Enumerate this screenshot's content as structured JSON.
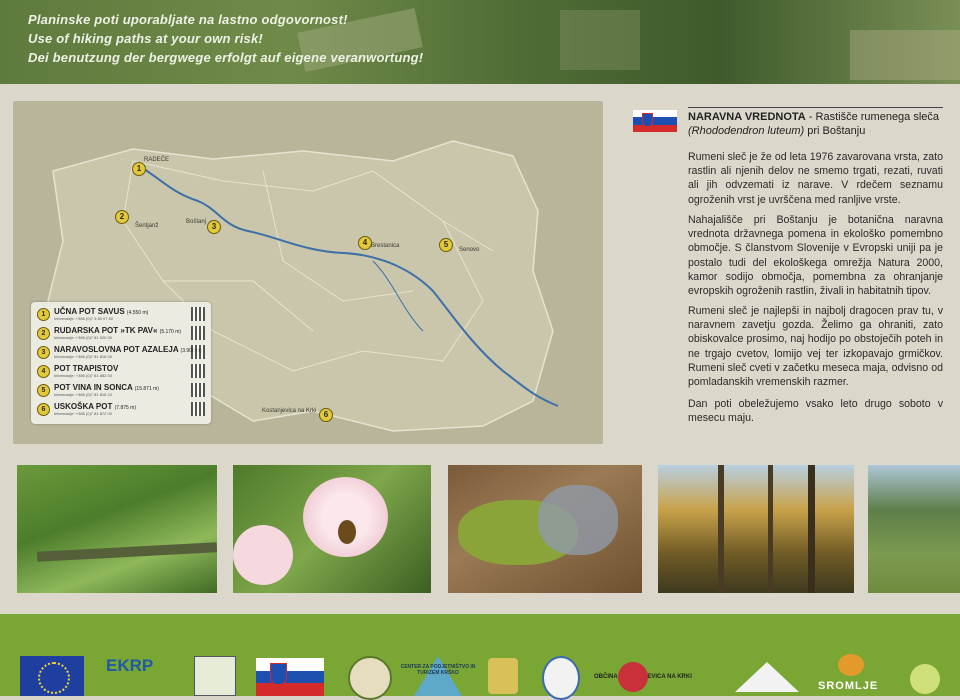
{
  "banner": {
    "lines": [
      "Planinske poti uporabljate na lastno odgovornost!",
      "Use of hiking paths at your own risk!",
      "Dei benutzung der bergwege erfolgt auf eigene veranwortung!"
    ]
  },
  "map": {
    "towns": [
      "RADEČE",
      "Šentjanž",
      "Boštanj",
      "Brestanica",
      "Senovo",
      "Kostanjevica na Krki"
    ],
    "markers": [
      "1",
      "2",
      "3",
      "4",
      "5",
      "6"
    ]
  },
  "legend": [
    {
      "num": "1",
      "name": "UČNA POT SAVUS",
      "len": "(4.550 m)",
      "info": "Informacije: +386 (0)7 3 80 07 60"
    },
    {
      "num": "2",
      "name": "RUDARSKA POT »TK PAV«",
      "len": "(5.170 m)",
      "info": "Informacije: +386 (0)7 81 920 00"
    },
    {
      "num": "3",
      "name": "NARAVOSLOVNA POT AZALEJA",
      "len": "(3.900 m)",
      "info": "Informacije: +386 (0)7 81 816 00"
    },
    {
      "num": "4",
      "name": "POT TRAPISTOV",
      "len": "",
      "info": "Informacije: +386 (0)7 81 882 00"
    },
    {
      "num": "5",
      "name": "POT VINA IN SONCA",
      "len": "(15.871 m)",
      "info": "Informacije: +386 (0)7 81 816 24"
    },
    {
      "num": "6",
      "name": "USKOŠKA POT",
      "len": "(7.875 m)",
      "info": "Informacije: +386 (0)7 81 872 00"
    }
  ],
  "article": {
    "title_bold": "NARAVNA VREDNOTA",
    "title_rest": " - Rastišče rumenega sleča",
    "title_italic": "(Rhododendron luteum)",
    "title_tail": " pri Boštanju",
    "p1": "Rumeni sleč je že od leta 1976 zavarovana vrsta, zato rastlin ali njenih delov ne smemo trgati, rezati, ruvati ali jih odvzemati iz narave. V rdečem seznamu ogroženih vrst je uvrščena med ranljive vrste.",
    "p2": "Nahajališče pri Boštanju je botanična naravna vrednota državnega pomena in ekološko pomembno območje. S članstvom Slovenije v Evropski uniji pa je postalo tudi del ekološkega omrežja Natura 2000, kamor sodijo območja, pomembna za ohranjanje evropskih ogroženih rastlin, živali in habitatnih tipov.",
    "p3": "Rumeni sleč je najlepši in najbolj dragocen prav tu, v naravnem zavetju gozda. Želimo ga ohraniti, zato obiskovalce prosimo, naj hodijo po obstoječih poteh in ne trgajo cvetov, lomijo vej ter izkopavajo grmičkov. Rumeni sleč cveti v začetku meseca maja, odvisno od pomladanskih vremenskih razmer.",
    "p4": "Dan poti obeležujemo vsako leto drugo soboto v mesecu maju."
  },
  "footer": {
    "logos": [
      "EKRP",
      "CENTER ZA PODJETNIŠTVO IN TURIZEM KRŠKO",
      "OBČINA KOSTANJEVICA NA KRKI",
      "SROMLJE"
    ]
  },
  "colors": {
    "footer": "#7aa634",
    "marker": "#e2c93a",
    "river": "#3d6fa8"
  }
}
